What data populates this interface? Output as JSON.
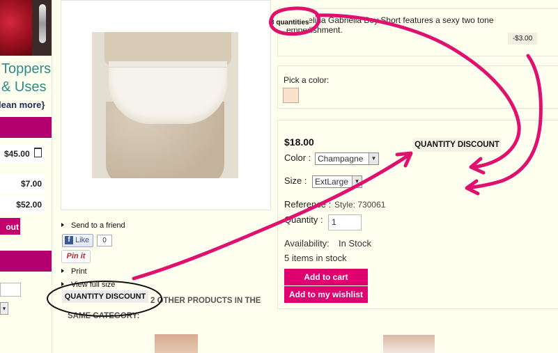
{
  "sidebar": {
    "promo_line1": "Toppers",
    "promo_line2": "& Uses",
    "promo_line3": "lean more}",
    "cart_rows": [
      "$45.00",
      "$7.00",
      "$52.00"
    ],
    "checkout_label": "out",
    "select_arrow": "▾"
  },
  "product": {
    "description": "The Felina Gabriella Boy Short features a sexy two tone embellishment.",
    "discount_tag": "-$3.00",
    "pick_color_label": "Pick a color:",
    "swatch_color": "#f9e3cf",
    "price": "$18.00",
    "color_label": "Color :",
    "color_value": "Champagne",
    "size_label": "Size :",
    "size_value": "ExtLarge",
    "reference_label": "Reference :",
    "reference_value": "Style: 730061",
    "quantity_label": "Quantity :",
    "quantity_value": "1",
    "availability_label": "Availability:",
    "availability_value": "In Stock",
    "stock_text": "5 items in stock",
    "add_to_cart": "Add to cart",
    "add_to_wishlist": "Add to my wishlist"
  },
  "actions": {
    "send_to_friend": "Send to a friend",
    "like_label": "Like",
    "like_count": "0",
    "pin_label": "Pin it",
    "print": "Print",
    "view_full_size": "View full size"
  },
  "annotations": {
    "quantity_discount_left": "QUANTITY DISCOUNT",
    "quantity_discount_right": "QUANTITY DISCOUNT",
    "quantities_note": "3 quantities",
    "ink_color": "#e0106e"
  },
  "related": {
    "line1": "2 OTHER PRODUCTS IN THE",
    "line2": "SAME CATEGORY:"
  },
  "colors": {
    "brand_magenta": "#e0006f",
    "page_bg": "#fffff0"
  }
}
